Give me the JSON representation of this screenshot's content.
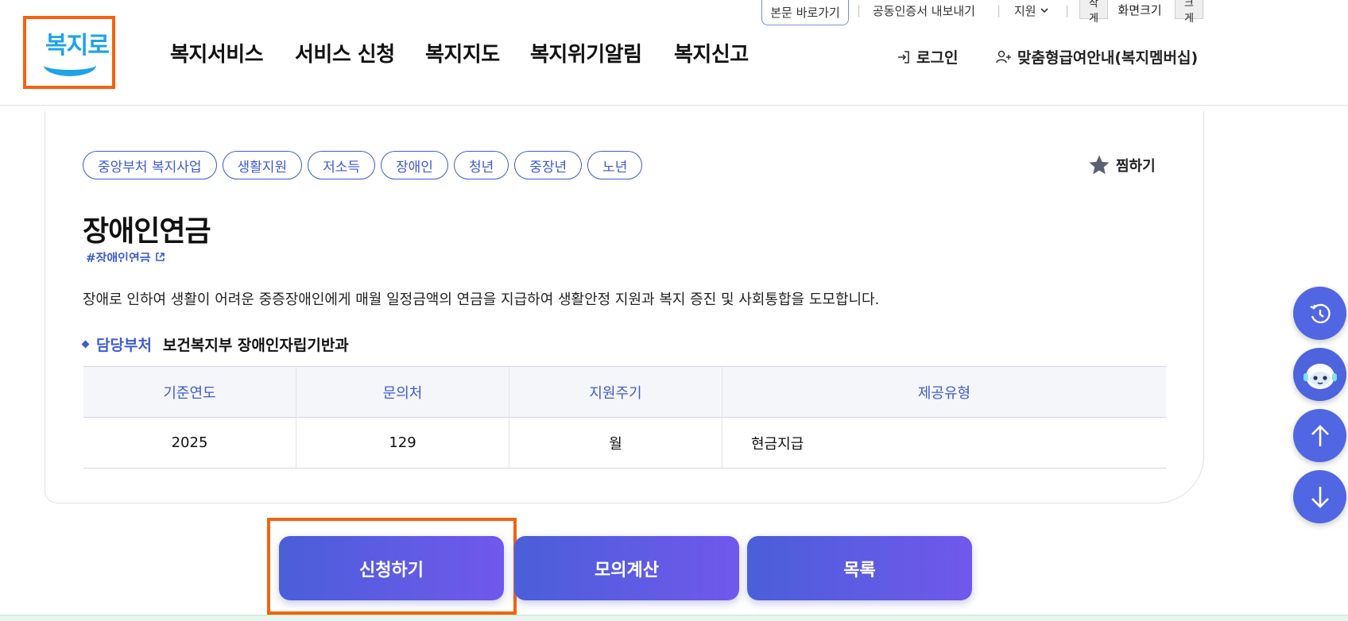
{
  "header": {
    "logo_text": "복지로",
    "utility": {
      "skip_link": "본문 바로가기",
      "cert_export": "공동인증서 내보내기",
      "support": "지원",
      "font_small": "작게",
      "font_size": "화면크기",
      "font_large": "크게"
    },
    "nav": [
      "복지서비스",
      "서비스 신청",
      "복지지도",
      "복지위기알림",
      "복지신고"
    ],
    "login": "로그인",
    "membership": "맞춤형급여안내(복지멤버십)"
  },
  "service": {
    "tags": [
      "중앙부처 복지사업",
      "생활지원",
      "저소득",
      "장애인",
      "청년",
      "중장년",
      "노년"
    ],
    "favorite": "찜하기",
    "title": "장애인연금",
    "hashtag": "#장애인연금",
    "description": "장애로 인하여 생활이 어려운 중증장애인에게 매월 일정금액의 연금을 지급하여 생활안정 지원과 복지 증진 및 사회통합을 도모합니다.",
    "department_label": "담당부처",
    "department_value": "보건복지부 장애인자립기반과",
    "table": {
      "headers": [
        "기준연도",
        "문의처",
        "지원주기",
        "제공유형"
      ],
      "row": [
        "2025",
        "129",
        "월",
        "현금지급"
      ]
    }
  },
  "actions": {
    "apply": "신청하기",
    "simulate": "모의계산",
    "list": "목록"
  },
  "floating": [
    "history-icon",
    "chatbot-icon",
    "arrow-up-icon",
    "arrow-down-icon"
  ],
  "colors": {
    "accent": "#3e5bd1",
    "button_gradient_start": "#4a5fd9",
    "button_gradient_end": "#7158ec",
    "highlight": "#f5620f",
    "logo": "#1fa3e8"
  }
}
